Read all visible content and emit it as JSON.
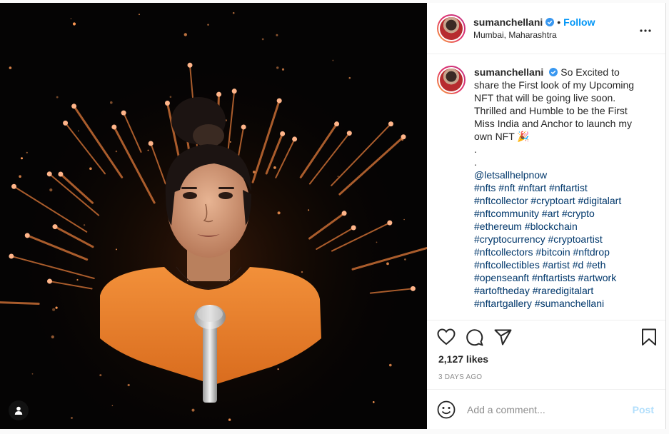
{
  "post": {
    "username": "sumanchellani",
    "follow_label": "Follow",
    "separator": "•",
    "location": "Mumbai, Maharashtra",
    "more_icon": "more-options-icon",
    "caption": {
      "username": "sumanchellani",
      "text": "So Excited to share the First look of my Upcoming NFT that will be going live soon. Thrilled and Humble to be the First Miss India and Anchor to launch my own NFT 🎉",
      "dot1": ".",
      "dot2": ".",
      "hashtags": [
        "@letsallhelpnow",
        "#nfts #nft #nftart #nftartist",
        "#nftcollector #cryptoart #digitalart",
        "#nftcommunity #art #crypto",
        "#ethereum #blockchain",
        "#cryptocurrency #cryptoartist",
        "#nftcollectors #bitcoin #nftdrop",
        "#nftcollectibles #artist #d #eth",
        "#openseanft #nftartists #artwork",
        "#artoftheday #raredigitalart",
        "#nftartgallery #sumanchellani"
      ],
      "age": "3d"
    },
    "likes": "2,127 likes",
    "date": "3 days ago",
    "comment_placeholder": "Add a comment...",
    "post_label": "Post"
  },
  "colors": {
    "accent": "#0095f6",
    "hashtag": "#00376b",
    "post_disabled": "#b2dffc",
    "dress": "#f08a2c"
  },
  "icons": [
    "heart-icon",
    "comment-icon",
    "share-icon",
    "bookmark-icon",
    "emoji-icon",
    "user-tag-icon",
    "verified-badge-icon"
  ]
}
